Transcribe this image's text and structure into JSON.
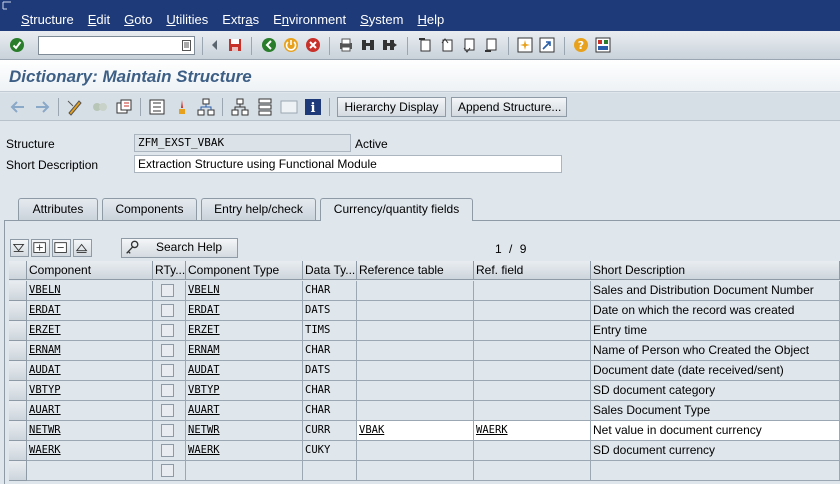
{
  "menu": [
    {
      "pre": "",
      "u": "S",
      "post": "tructure"
    },
    {
      "pre": "",
      "u": "E",
      "post": "dit"
    },
    {
      "pre": "",
      "u": "G",
      "post": "oto"
    },
    {
      "pre": "",
      "u": "U",
      "post": "tilities"
    },
    {
      "pre": "Extr",
      "u": "a",
      "post": "s"
    },
    {
      "pre": "E",
      "u": "n",
      "post": "vironment"
    },
    {
      "pre": "",
      "u": "S",
      "post": "ystem"
    },
    {
      "pre": "",
      "u": "H",
      "post": "elp"
    }
  ],
  "command_field": {
    "value": ""
  },
  "title": "Dictionary: Maintain Structure",
  "app_toolbar": {
    "hierarchy_display": "Hierarchy Display",
    "append_structure": "Append Structure..."
  },
  "structure": {
    "label": "Structure",
    "value": "ZFM_EXST_VBAK",
    "status": "Active"
  },
  "short_description": {
    "label": "Short Description",
    "value": "Extraction Structure using Functional Module"
  },
  "tabs": [
    "Attributes",
    "Components",
    "Entry help/check",
    "Currency/quantity fields"
  ],
  "table": {
    "search_help": "Search Help",
    "page_current": "1",
    "page_sep": "/",
    "page_total": "9",
    "columns": [
      "Component",
      "RTy...",
      "Component Type",
      "Data Ty...",
      "Reference table",
      "Ref. field",
      "Short Description"
    ],
    "rows": [
      {
        "component": "VBELN",
        "component_type": "VBELN",
        "data_type": "CHAR",
        "ref_table": "",
        "ref_field": "",
        "description": "Sales and Distribution Document Number"
      },
      {
        "component": "ERDAT",
        "component_type": "ERDAT",
        "data_type": "DATS",
        "ref_table": "",
        "ref_field": "",
        "description": "Date on which the record was created"
      },
      {
        "component": "ERZET",
        "component_type": "ERZET",
        "data_type": "TIMS",
        "ref_table": "",
        "ref_field": "",
        "description": "Entry time"
      },
      {
        "component": "ERNAM",
        "component_type": "ERNAM",
        "data_type": "CHAR",
        "ref_table": "",
        "ref_field": "",
        "description": "Name of Person who Created the Object"
      },
      {
        "component": "AUDAT",
        "component_type": "AUDAT",
        "data_type": "DATS",
        "ref_table": "",
        "ref_field": "",
        "description": "Document date (date received/sent)"
      },
      {
        "component": "VBTYP",
        "component_type": "VBTYP",
        "data_type": "CHAR",
        "ref_table": "",
        "ref_field": "",
        "description": "SD document category"
      },
      {
        "component": "AUART",
        "component_type": "AUART",
        "data_type": "CHAR",
        "ref_table": "",
        "ref_field": "",
        "description": "Sales Document Type"
      },
      {
        "component": "NETWR",
        "component_type": "NETWR",
        "data_type": "CURR",
        "ref_table": "VBAK",
        "ref_field": "WAERK",
        "description": "Net value in document currency"
      },
      {
        "component": "WAERK",
        "component_type": "WAERK",
        "data_type": "CUKY",
        "ref_table": "",
        "ref_field": "",
        "description": "SD document currency"
      },
      {
        "component": "",
        "component_type": "",
        "data_type": "",
        "ref_table": "",
        "ref_field": "",
        "description": ""
      }
    ]
  }
}
